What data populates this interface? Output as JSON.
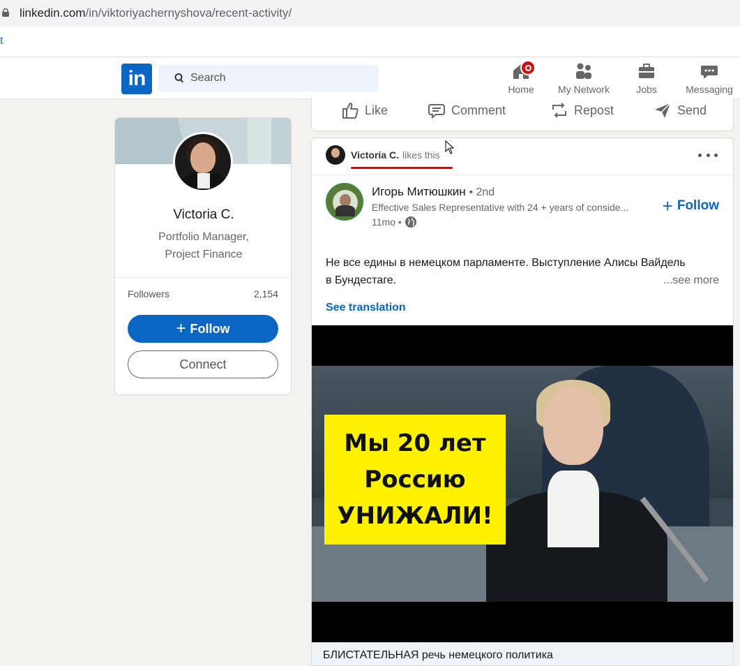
{
  "browser": {
    "url_host": "linkedin.com",
    "url_path": "/in/viktoriyachernyshova/recent-activity/",
    "bookmark_fragment": "t"
  },
  "nav": {
    "logo": "in",
    "search_placeholder": "Search",
    "items": [
      {
        "label": "Home",
        "icon": "home-icon"
      },
      {
        "label": "My Network",
        "icon": "network-icon"
      },
      {
        "label": "Jobs",
        "icon": "briefcase-icon"
      },
      {
        "label": "Messaging",
        "icon": "messaging-icon"
      }
    ]
  },
  "profile": {
    "name": "Victoria C.",
    "title_line1": "Portfolio Manager,",
    "title_line2": "Project Finance",
    "followers_label": "Followers",
    "followers_count": "2,154",
    "follow_label": "Follow",
    "connect_label": "Connect"
  },
  "actions": {
    "like": "Like",
    "comment": "Comment",
    "repost": "Repost",
    "send": "Send"
  },
  "post": {
    "liker_name": "Victoria C.",
    "liker_action": "likes this",
    "author_name": "Игорь Митюшкин",
    "author_degree": "• 2nd",
    "author_headline": "Effective Sales Representative with 24 + years of conside...",
    "time": "11mo •",
    "follow_label": "Follow",
    "text_line1": "Не все едины в немецком парламенте. Выступление Алисы Вайдель",
    "text_line2": "в Бундестаге.",
    "see_more": "...see more",
    "see_translation": "See translation",
    "video_caption": [
      "Мы 20 лет",
      "Россию",
      "УНИЖАЛИ!"
    ],
    "video_title": "БЛИСТАТЕЛЬНАЯ речь немецкого политика"
  },
  "colors": {
    "brand": "#0a66c2",
    "badge": "#cc1016",
    "underline": "#e00000",
    "caption_bg": "#fff200"
  }
}
